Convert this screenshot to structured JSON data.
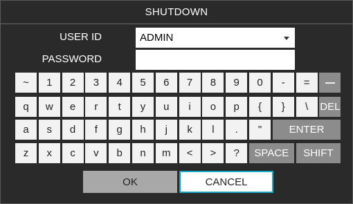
{
  "title": "SHUTDOWN",
  "form": {
    "user_id_label": "USER ID",
    "user_id_value": "ADMIN",
    "password_label": "PASSWORD",
    "password_value": ""
  },
  "keyboard": {
    "row1": [
      "~",
      "1",
      "2",
      "3",
      "4",
      "5",
      "6",
      "7",
      "8",
      "9",
      "0",
      "-",
      "="
    ],
    "row2": [
      "q",
      "w",
      "e",
      "r",
      "t",
      "y",
      "u",
      "i",
      "o",
      "p",
      "{",
      "}",
      "\\"
    ],
    "row3": [
      "a",
      "s",
      "d",
      "f",
      "g",
      "h",
      "j",
      "k",
      "l",
      ".",
      "\""
    ],
    "row4": [
      "z",
      "x",
      "c",
      "v",
      "b",
      "n",
      "m",
      "<",
      ">",
      "?"
    ],
    "backspace_icon": "backspace-icon",
    "del_label": "DEL",
    "enter_label": "ENTER",
    "space_label": "SPACE",
    "shift_label": "SHIFT"
  },
  "buttons": {
    "ok_label": "OK",
    "cancel_label": "CANCEL"
  },
  "colors": {
    "background": "#2a2a2a",
    "key": "#f2f2f2",
    "special_key": "#8c8c8c",
    "focus_border": "#1aa9c4"
  }
}
